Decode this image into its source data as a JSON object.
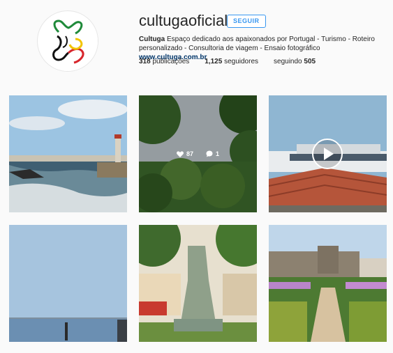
{
  "profile": {
    "username": "cultugaoficial",
    "follow_label": "SEGUIR",
    "bio_name": "Cultuga",
    "bio_text": " Espaço dedicado aos apaixonados por Portugal - Turismo - Roteiro personalizado - Consultoria de viagem - Ensaio fotográfico ",
    "website": "www.cultuga.com.br",
    "stats": {
      "posts_count": "318",
      "posts_label": " publicações",
      "followers_count": "1,125",
      "followers_label": " seguidores",
      "following_label": "seguindo ",
      "following_count": "505"
    }
  },
  "posts": {
    "hover": {
      "likes": "87",
      "comments": "1"
    }
  },
  "icons": [
    "heart-icon",
    "comment-icon",
    "play-icon"
  ],
  "colors": {
    "accent": "#3897f0",
    "link": "#003569",
    "background": "#fafafa"
  }
}
